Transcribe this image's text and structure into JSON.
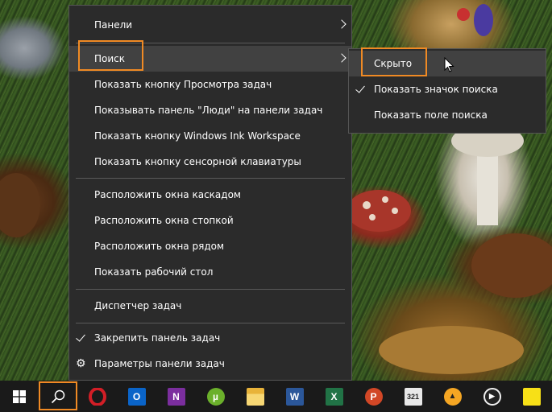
{
  "context_menu": {
    "items": [
      {
        "label": "Панели"
      },
      {
        "label": "Поиск"
      },
      {
        "label": "Показать кнопку Просмотра задач"
      },
      {
        "label": "Показывать панель \"Люди\" на панели задач"
      },
      {
        "label": "Показать кнопку Windows Ink Workspace"
      },
      {
        "label": "Показать кнопку сенсорной клавиатуры"
      },
      {
        "label": "Расположить окна каскадом"
      },
      {
        "label": "Расположить окна стопкой"
      },
      {
        "label": "Расположить окна рядом"
      },
      {
        "label": "Показать рабочий стол"
      },
      {
        "label": "Диспетчер задач"
      },
      {
        "label": "Закрепить панель задач"
      },
      {
        "label": "Параметры панели задач"
      }
    ]
  },
  "search_submenu": {
    "items": [
      {
        "label": "Скрыто"
      },
      {
        "label": "Показать значок поиска"
      },
      {
        "label": "Показать поле поиска"
      }
    ]
  },
  "taskbar": {
    "icons": [
      {
        "name": "windows-start-icon"
      },
      {
        "name": "search-icon"
      },
      {
        "name": "opera-icon",
        "glyph": "O",
        "color": "#d31e26"
      },
      {
        "name": "outlook-icon",
        "glyph": "O",
        "color": "#0a64c8"
      },
      {
        "name": "onenote-icon",
        "glyph": "N",
        "color": "#7b2e9e"
      },
      {
        "name": "utorrent-icon",
        "glyph": "µ",
        "color": "#6bb02b"
      },
      {
        "name": "file-explorer-icon",
        "glyph": "",
        "color": "#f2c14e"
      },
      {
        "name": "word-icon",
        "glyph": "W",
        "color": "#2b579a"
      },
      {
        "name": "excel-icon",
        "glyph": "X",
        "color": "#217346"
      },
      {
        "name": "powerpoint-icon",
        "glyph": "P",
        "color": "#d24726"
      },
      {
        "name": "calendar-321-icon",
        "glyph": "321",
        "color": "#e8e8e8"
      },
      {
        "name": "aimp-icon",
        "glyph": "▲",
        "color": "#f5a623"
      },
      {
        "name": "media-player-icon",
        "glyph": "▶",
        "color": "#f0f0f0"
      },
      {
        "name": "sticky-notes-icon",
        "glyph": "",
        "color": "#f7e017"
      }
    ]
  },
  "accent_color": "#f08a24"
}
